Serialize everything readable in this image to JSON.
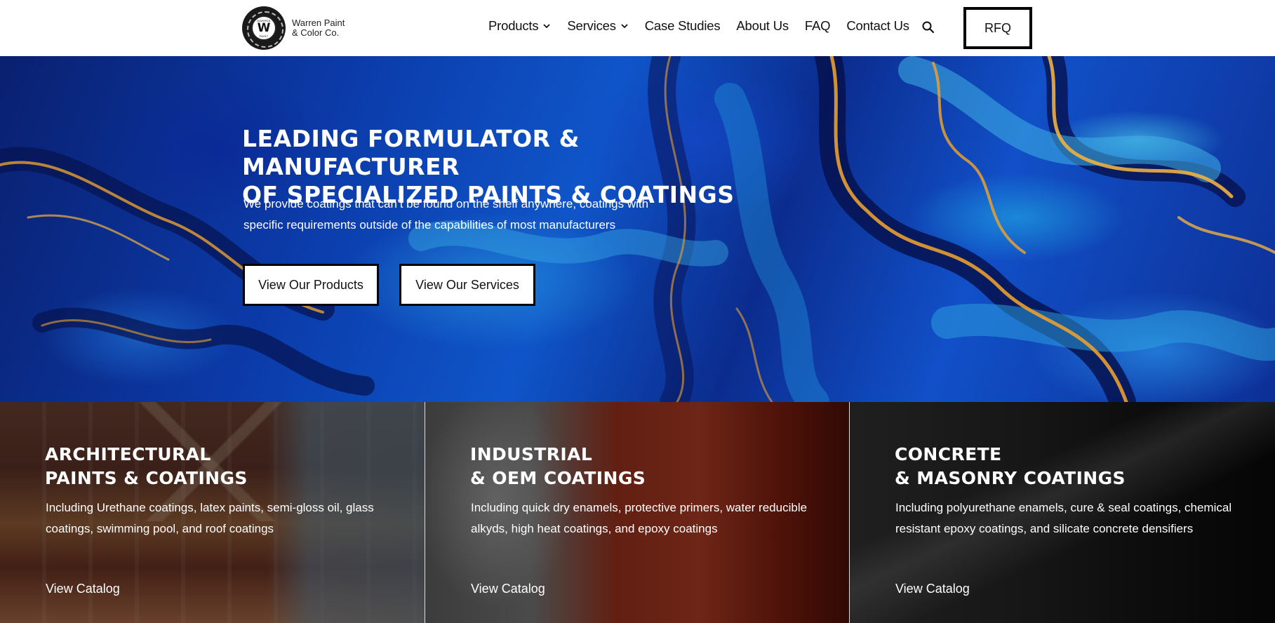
{
  "header": {
    "logo": {
      "line1": "Warren Paint",
      "line2": "& Color Co.",
      "badge_letter": "W",
      "badge_top": "WARREN",
      "badge_bottom": "PAINT"
    },
    "nav": [
      {
        "label": "Products",
        "has_dropdown": true
      },
      {
        "label": "Services",
        "has_dropdown": true
      },
      {
        "label": "Case Studies",
        "has_dropdown": false
      },
      {
        "label": "About Us",
        "has_dropdown": false
      },
      {
        "label": "FAQ",
        "has_dropdown": false
      },
      {
        "label": "Contact Us",
        "has_dropdown": false
      }
    ],
    "search_icon": "search-icon",
    "rfq_label": "RFQ"
  },
  "hero": {
    "title_line1": "Leading Formulator & Manufacturer",
    "title_line2": "of Specialized Paints & Coatings",
    "subtitle": "We provide coatings that can’t be found on the shelf anywhere, coatings with specific requirements outside of the capabilities of most manufacturers",
    "buttons": {
      "products": "View Our Products",
      "services": "View Our Services"
    }
  },
  "cards": [
    {
      "title_line1": "Architectural",
      "title_line2": "Paints & Coatings",
      "description": "Including Urethane coatings, latex paints, semi-gloss oil, glass coatings, swimming pool, and roof coatings",
      "link": "View Catalog"
    },
    {
      "title_line1": "Industrial",
      "title_line2": "& OEM Coatings",
      "description": "Including quick dry enamels, protective primers, water reducible alkyds, high heat coatings, and epoxy coatings",
      "link": "View Catalog"
    },
    {
      "title_line1": "Concrete",
      "title_line2": "& Masonry Coatings",
      "description": "Including polyurethane enamels, cure & seal coatings, chemical resistant epoxy coatings, and silicate concrete densifiers",
      "link": "View Catalog"
    }
  ],
  "colors": {
    "header_bg": "#ffffff",
    "hero_blue": "#0b3aa8",
    "marble_gold": "#e9a030",
    "button_border": "#000000",
    "text_white": "#ffffff"
  }
}
